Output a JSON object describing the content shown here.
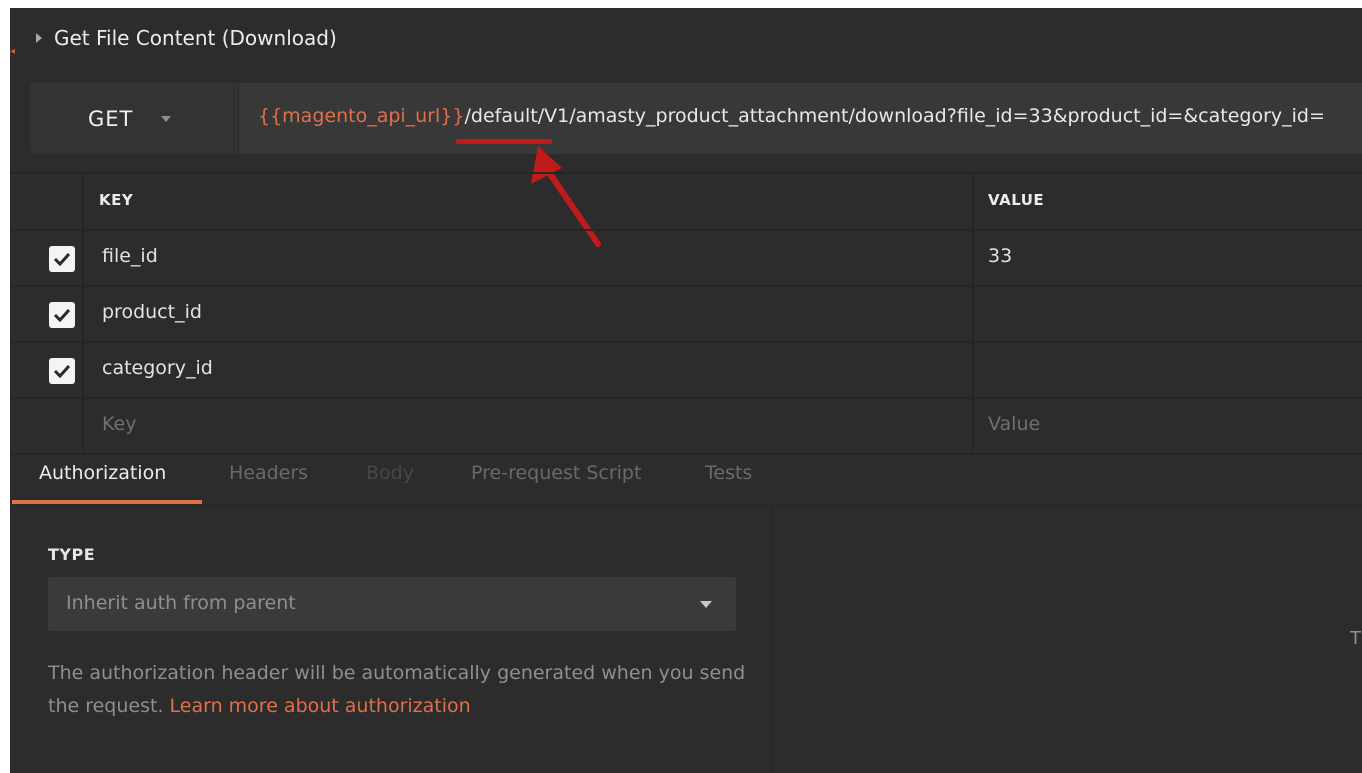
{
  "request": {
    "name": "Get File Content (Download)"
  },
  "url_bar": {
    "method": "GET",
    "url_variable": "{{magento_api_url}}",
    "url_path": "/default/V1/amasty_product_attachment/download?file_id=33&product_id=&category_id="
  },
  "params": {
    "key_header": "KEY",
    "value_header": "VALUE",
    "rows": [
      {
        "checked": true,
        "key": "file_id",
        "value": "33"
      },
      {
        "checked": true,
        "key": "product_id",
        "value": ""
      },
      {
        "checked": true,
        "key": "category_id",
        "value": ""
      }
    ],
    "key_placeholder": "Key",
    "value_placeholder": "Value"
  },
  "tabs": [
    {
      "label": "Authorization",
      "active": true
    },
    {
      "label": "Headers",
      "active": false
    },
    {
      "label": "Body",
      "active": false
    },
    {
      "label": "Pre-request Script",
      "active": false
    },
    {
      "label": "Tests",
      "active": false
    }
  ],
  "auth": {
    "type_label": "TYPE",
    "type_value": "Inherit auth from parent",
    "description": "The authorization header will be automatically generated when you send the request.",
    "link_text": "Learn more about authorization"
  },
  "right_panel": {
    "partial_text": "T"
  },
  "colors": {
    "background": "#2c2c2c",
    "accent": "#e0704a",
    "annotation": "#c01a1a"
  }
}
